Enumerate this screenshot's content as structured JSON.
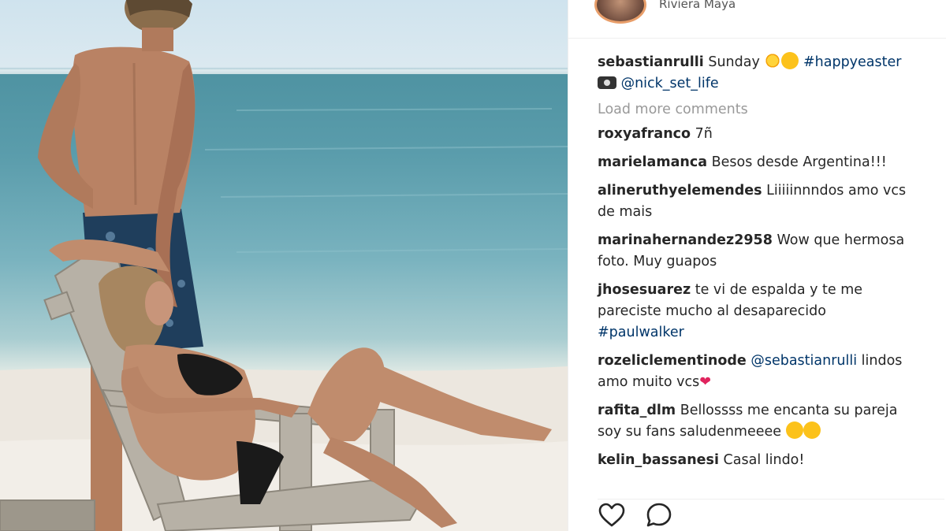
{
  "header": {
    "location": "Riviera Maya"
  },
  "post": {
    "caption": {
      "user": "sebastianrulli",
      "text": "Sunday",
      "hashtag": "#happyeaster",
      "credit_mention": "@nick_set_life"
    },
    "load_more_label": "Load more comments",
    "comments": [
      {
        "user": "roxyafranco",
        "text": "7ñ"
      },
      {
        "user": "marielamanca",
        "text": "Besos desde Argentina!!!"
      },
      {
        "user": "alineruthyelemendes",
        "text": "Liiiiinnndos amo vcs de mais"
      },
      {
        "user": "marinahernandez2958",
        "text": "Wow que hermosa foto. Muy guapos"
      },
      {
        "user": "jhosesuarez",
        "text": "te vi de espalda y te me pareciste mucho al desaparecido",
        "hashtag": "#paulwalker"
      },
      {
        "user": "rozeliclementinode",
        "mention": "@sebastianrulli",
        "text": "lindos amo muito vcs"
      },
      {
        "user": "rafita_dlm",
        "text": "Bellossss me encanta su pareja soy su fans saludenmeeee"
      },
      {
        "user": "kelin_bassanesi",
        "text": "Casal lindo!"
      }
    ]
  },
  "actions": {
    "like_icon": "heart-outline-icon",
    "comment_icon": "speech-bubble-icon"
  },
  "colors": {
    "link": "#003569",
    "muted": "#999999",
    "text": "#262626"
  }
}
